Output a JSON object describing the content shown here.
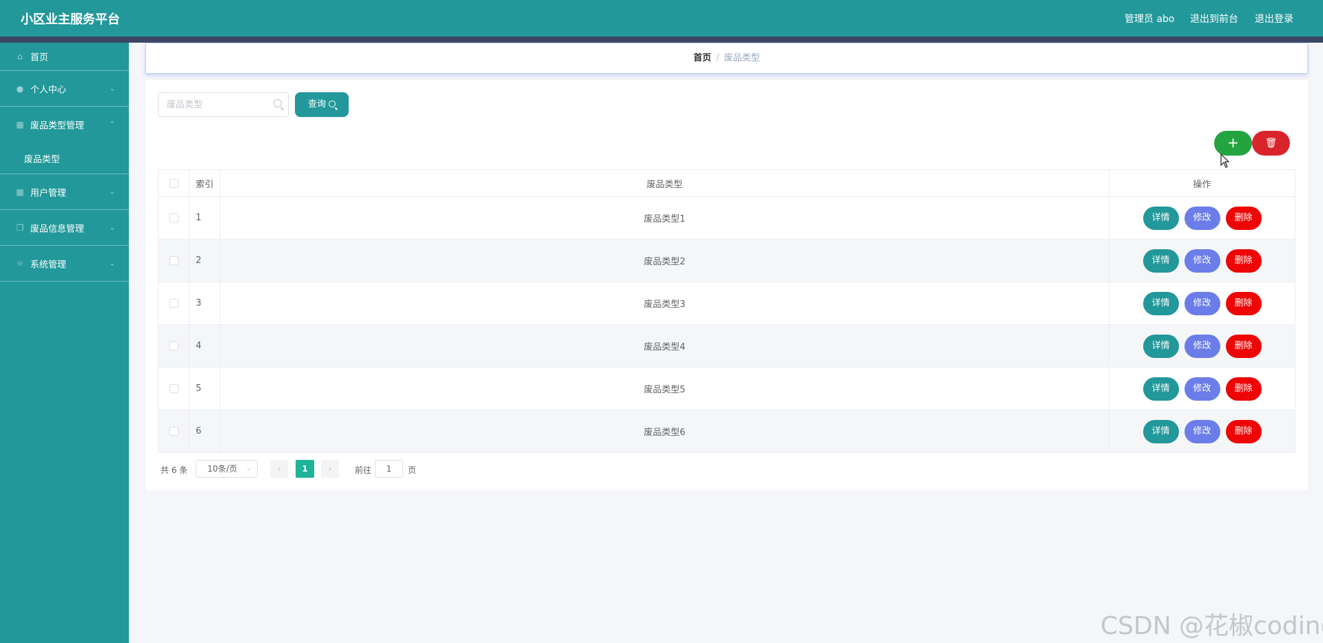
{
  "header": {
    "app_title": "小区业主服务平台",
    "user_label": "管理员 abo",
    "to_frontend_link": "退出到前台",
    "logout_link": "退出登录",
    "bg_color": "#22989a"
  },
  "sidebar": {
    "items": [
      {
        "label": "首页",
        "icon": "home-icon"
      },
      {
        "label": "个人中心",
        "icon": "user-icon"
      },
      {
        "label": "废品类型管理",
        "icon": "grid-icon",
        "expanded": true
      },
      {
        "label": "用户管理",
        "icon": "briefcase-icon"
      },
      {
        "label": "废品信息管理",
        "icon": "copy-icon"
      },
      {
        "label": "系统管理",
        "icon": "settings-icon"
      }
    ],
    "subitem": "废品类型"
  },
  "breadcrumb": {
    "home": "首页",
    "separator": "/",
    "current": "废品类型"
  },
  "search": {
    "placeholder": "废品类型",
    "value": "",
    "button_label": "查询"
  },
  "actions": {
    "add_label": "+",
    "delete_label": "🗑"
  },
  "table": {
    "headers": [
      "索引",
      "废品类型",
      "操作"
    ],
    "rows": [
      {
        "index": "1",
        "type": "废品类型1"
      },
      {
        "index": "2",
        "type": "废品类型2"
      },
      {
        "index": "3",
        "type": "废品类型3"
      },
      {
        "index": "4",
        "type": "废品类型4"
      },
      {
        "index": "5",
        "type": "废品类型5"
      },
      {
        "index": "6",
        "type": "废品类型6"
      }
    ],
    "op_labels": {
      "detail": "详情",
      "edit": "修改",
      "delete": "删除"
    }
  },
  "pagination": {
    "total_text": "共 6 条",
    "page_size": "10条/页",
    "current_page": "1",
    "goto_label": "前往",
    "goto_value": "1",
    "page_suffix": "页"
  },
  "watermark": "CSDN @花椒coding"
}
